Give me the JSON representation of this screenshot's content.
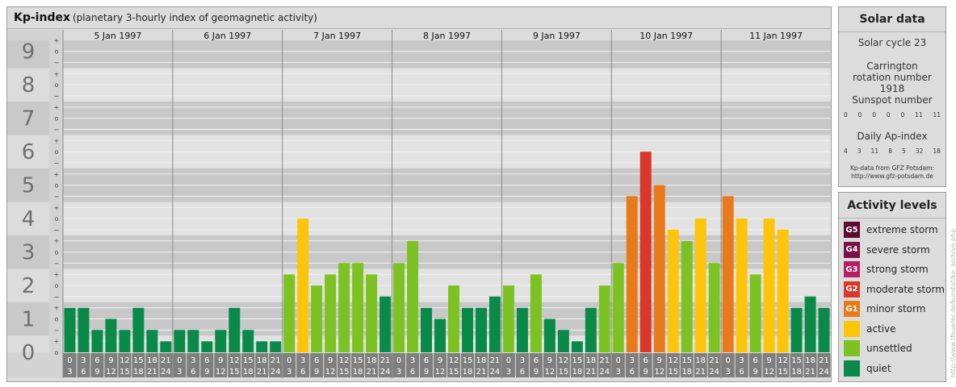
{
  "header": {
    "title": "Kp-index",
    "subtitle": "(planetary 3-hourly index of geomagnetic activity)"
  },
  "chart_data": {
    "type": "bar",
    "title": "Kp-index",
    "subtitle": "(planetary 3-hourly index of geomagnetic activity)",
    "days": [
      "5 Jan 1997",
      "6 Jan 1997",
      "7 Jan 1997",
      "8 Jan 1997",
      "9 Jan 1997",
      "10 Jan 1997",
      "11 Jan 1997"
    ],
    "interval_start_labels": [
      "0",
      "3",
      "6",
      "9",
      "12",
      "15",
      "18",
      "21"
    ],
    "interval_end_labels": [
      "3",
      "6",
      "9",
      "12",
      "15",
      "18",
      "21",
      "24"
    ],
    "y_major_labels": [
      "0",
      "1",
      "2",
      "3",
      "4",
      "5",
      "6",
      "7",
      "8",
      "9"
    ],
    "y_minor_labels": [
      "−",
      "o",
      "+"
    ],
    "ylim": [
      0,
      9.33
    ],
    "values": [
      [
        1.33,
        1.33,
        0.67,
        1.0,
        0.67,
        1.33,
        0.67,
        0.33
      ],
      [
        0.67,
        0.67,
        0.33,
        0.67,
        1.33,
        0.67,
        0.33,
        0.33
      ],
      [
        2.33,
        4.0,
        2.0,
        2.33,
        2.67,
        2.67,
        2.33,
        1.67
      ],
      [
        2.67,
        3.33,
        1.33,
        1.0,
        2.0,
        1.33,
        1.33,
        1.67
      ],
      [
        2.0,
        1.33,
        2.33,
        1.0,
        0.67,
        0.33,
        1.33,
        2.0
      ],
      [
        2.67,
        4.67,
        6.0,
        5.0,
        3.67,
        3.33,
        4.0,
        2.67
      ],
      [
        4.67,
        4.0,
        2.33,
        4.0,
        3.67,
        1.33,
        1.67,
        1.33
      ]
    ],
    "grid": true
  },
  "solar": {
    "title": "Solar data",
    "cycle": "Solar cycle 23",
    "carrington": "Carrington rotation number 1918",
    "sunspot_title": "Sunspot number",
    "sunspot_values": [
      "0",
      "0",
      "0",
      "0",
      "0",
      "11",
      "11"
    ],
    "ap_title": "Daily Ap-index",
    "ap_values": [
      "4",
      "3",
      "11",
      "8",
      "5",
      "32",
      "18"
    ],
    "source_line1": "Kp-data from GFZ Potsdam:",
    "source_line2": "http://www.gfz-potsdam.de"
  },
  "activity": {
    "title": "Activity levels",
    "levels": [
      {
        "code": "G5",
        "label": "extreme storm",
        "color": "#5c0a2e"
      },
      {
        "code": "G4",
        "label": "severe storm",
        "color": "#7a1048"
      },
      {
        "code": "G3",
        "label": "strong storm",
        "color": "#b51f64"
      },
      {
        "code": "G2",
        "label": "moderate storm",
        "color": "#d9382a"
      },
      {
        "code": "G1",
        "label": "minor storm",
        "color": "#e87a1c"
      },
      {
        "code": "",
        "label": "active",
        "color": "#fcc50a"
      },
      {
        "code": "",
        "label": "unsettled",
        "color": "#7dc223"
      },
      {
        "code": "",
        "label": "quiet",
        "color": "#0a8a48"
      }
    ]
  },
  "credit": "http://www.tfeuerer.de/kurstat/kp_archive.php",
  "colors": {
    "band_dark": "#c8c8c8",
    "band_light": "#e2e2e2",
    "axis_bg": "#dcdcdc",
    "hour_cell": "#7f7f7f",
    "separator": "#8a8a8a"
  }
}
